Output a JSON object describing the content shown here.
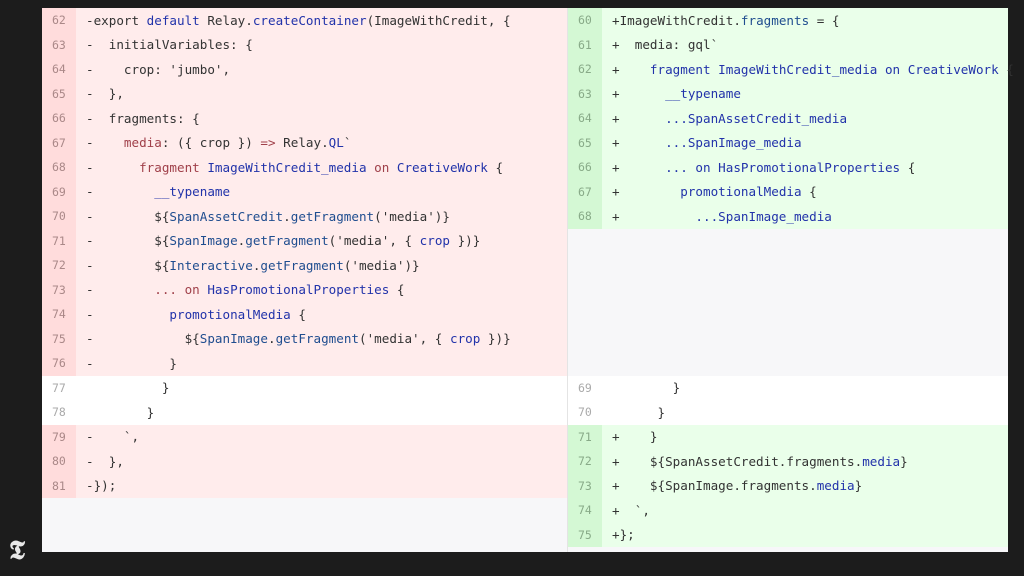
{
  "left": {
    "rows": [
      {
        "n": "62",
        "t": "del",
        "segs": [
          [
            "-export ",
            ""
          ],
          [
            "default ",
            "b"
          ],
          [
            "Relay.",
            ""
          ],
          [
            "createContainer",
            "b"
          ],
          [
            "(ImageWithCredit, {",
            ""
          ]
        ]
      },
      {
        "n": "63",
        "t": "del",
        "segs": [
          [
            "-  initialVariables: {",
            ""
          ]
        ]
      },
      {
        "n": "64",
        "t": "del",
        "segs": [
          [
            "-    crop: 'jumbo',",
            ""
          ]
        ]
      },
      {
        "n": "65",
        "t": "del",
        "segs": [
          [
            "-  },",
            ""
          ]
        ]
      },
      {
        "n": "66",
        "t": "del",
        "segs": [
          [
            "-  fragments: {",
            ""
          ]
        ]
      },
      {
        "n": "67",
        "t": "del",
        "segs": [
          [
            "-    ",
            ""
          ],
          [
            "media",
            "k"
          ],
          [
            ": ({ crop }) ",
            ""
          ],
          [
            "=>",
            "k"
          ],
          [
            " Relay.",
            ""
          ],
          [
            "QL",
            "b"
          ],
          [
            "`",
            ""
          ]
        ]
      },
      {
        "n": "68",
        "t": "del",
        "segs": [
          [
            "-      ",
            ""
          ],
          [
            "fragment ",
            "k"
          ],
          [
            "ImageWithCredit_media ",
            "b"
          ],
          [
            "on ",
            "k"
          ],
          [
            "CreativeWork",
            "b"
          ],
          [
            " {",
            ""
          ]
        ]
      },
      {
        "n": "69",
        "t": "del",
        "segs": [
          [
            "-        ",
            ""
          ],
          [
            "__typename",
            "b"
          ]
        ]
      },
      {
        "n": "70",
        "t": "del",
        "segs": [
          [
            "-        ${",
            ""
          ],
          [
            "SpanAssetCredit",
            "s"
          ],
          [
            ".",
            ""
          ],
          [
            "getFragment",
            "s"
          ],
          [
            "('media')}",
            ""
          ]
        ]
      },
      {
        "n": "71",
        "t": "del",
        "segs": [
          [
            "-        ${",
            ""
          ],
          [
            "SpanImage",
            "s"
          ],
          [
            ".",
            ""
          ],
          [
            "getFragment",
            "s"
          ],
          [
            "('media', { ",
            ""
          ],
          [
            "crop",
            "b"
          ],
          [
            " })}",
            ""
          ]
        ]
      },
      {
        "n": "72",
        "t": "del",
        "segs": [
          [
            "-        ${",
            ""
          ],
          [
            "Interactive",
            "s"
          ],
          [
            ".",
            ""
          ],
          [
            "getFragment",
            "s"
          ],
          [
            "('media')}",
            ""
          ]
        ]
      },
      {
        "n": "73",
        "t": "del",
        "segs": [
          [
            "-        ",
            ""
          ],
          [
            "... on ",
            "k"
          ],
          [
            "HasPromotionalProperties",
            "b"
          ],
          [
            " {",
            ""
          ]
        ]
      },
      {
        "n": "74",
        "t": "del",
        "segs": [
          [
            "-          ",
            ""
          ],
          [
            "promotionalMedia",
            "b"
          ],
          [
            " {",
            ""
          ]
        ]
      },
      {
        "n": "75",
        "t": "del",
        "segs": [
          [
            "-            ${",
            ""
          ],
          [
            "SpanImage",
            "s"
          ],
          [
            ".",
            ""
          ],
          [
            "getFragment",
            "s"
          ],
          [
            "('media', { ",
            ""
          ],
          [
            "crop",
            "b"
          ],
          [
            " })}",
            ""
          ]
        ]
      },
      {
        "n": "76",
        "t": "del",
        "segs": [
          [
            "-          }",
            ""
          ]
        ]
      },
      {
        "n": "77",
        "t": "ctx",
        "segs": [
          [
            "          }",
            ""
          ]
        ]
      },
      {
        "n": "78",
        "t": "ctx",
        "segs": [
          [
            "        }",
            ""
          ]
        ]
      },
      {
        "n": "79",
        "t": "del",
        "segs": [
          [
            "-    `,",
            ""
          ]
        ]
      },
      {
        "n": "80",
        "t": "del",
        "segs": [
          [
            "-  },",
            ""
          ]
        ]
      },
      {
        "n": "81",
        "t": "del",
        "segs": [
          [
            "-});",
            ""
          ]
        ]
      }
    ]
  },
  "right": {
    "rows": [
      {
        "n": "60",
        "t": "add",
        "segs": [
          [
            "+ImageWithCredit.",
            ""
          ],
          [
            "fragments",
            "s"
          ],
          [
            " = {",
            ""
          ]
        ]
      },
      {
        "n": "61",
        "t": "add",
        "segs": [
          [
            "+  media: gql`",
            ""
          ]
        ]
      },
      {
        "n": "62",
        "t": "add",
        "segs": [
          [
            "+    ",
            ""
          ],
          [
            "fragment ImageWithCredit_media on CreativeWork",
            "b"
          ],
          [
            " {",
            ""
          ]
        ]
      },
      {
        "n": "63",
        "t": "add",
        "segs": [
          [
            "+      ",
            ""
          ],
          [
            "__typename",
            "b"
          ]
        ]
      },
      {
        "n": "64",
        "t": "add",
        "segs": [
          [
            "+      ",
            ""
          ],
          [
            "...SpanAssetCredit_media",
            "b"
          ]
        ]
      },
      {
        "n": "65",
        "t": "add",
        "segs": [
          [
            "+      ",
            ""
          ],
          [
            "...SpanImage_media",
            "b"
          ]
        ]
      },
      {
        "n": "66",
        "t": "add",
        "segs": [
          [
            "+      ",
            ""
          ],
          [
            "... on HasPromotionalProperties",
            "b"
          ],
          [
            " {",
            ""
          ]
        ]
      },
      {
        "n": "67",
        "t": "add",
        "segs": [
          [
            "+        ",
            ""
          ],
          [
            "promotionalMedia",
            "b"
          ],
          [
            " {",
            ""
          ]
        ]
      },
      {
        "n": "68",
        "t": "add",
        "segs": [
          [
            "+          ",
            ""
          ],
          [
            "...SpanImage_media",
            "b"
          ]
        ]
      },
      {
        "n": "",
        "t": "empty",
        "segs": []
      },
      {
        "n": "",
        "t": "empty",
        "segs": []
      },
      {
        "n": "",
        "t": "empty",
        "segs": []
      },
      {
        "n": "",
        "t": "empty",
        "segs": []
      },
      {
        "n": "",
        "t": "empty",
        "segs": []
      },
      {
        "n": "",
        "t": "empty",
        "segs": []
      },
      {
        "n": "69",
        "t": "ctx",
        "segs": [
          [
            "        }",
            ""
          ]
        ]
      },
      {
        "n": "70",
        "t": "ctx",
        "segs": [
          [
            "      }",
            ""
          ]
        ]
      },
      {
        "n": "71",
        "t": "add",
        "segs": [
          [
            "+    }",
            ""
          ]
        ]
      },
      {
        "n": "72",
        "t": "add",
        "segs": [
          [
            "+    ${SpanAssetCredit.fragments.",
            ""
          ],
          [
            "media",
            "b"
          ],
          [
            "}",
            ""
          ]
        ]
      },
      {
        "n": "73",
        "t": "add",
        "segs": [
          [
            "+    ${SpanImage.fragments.",
            ""
          ],
          [
            "media",
            "b"
          ],
          [
            "}",
            ""
          ]
        ]
      },
      {
        "n": "74",
        "t": "add",
        "segs": [
          [
            "+  `,",
            ""
          ]
        ]
      },
      {
        "n": "75",
        "t": "add",
        "segs": [
          [
            "+};",
            ""
          ]
        ]
      }
    ]
  },
  "colors": {
    "deleted_bg": "#ffecec",
    "added_bg": "#eaffea",
    "keyword": "#a0404a",
    "identifier": "#2233aa"
  },
  "logo": {
    "glyph": "𝕿",
    "icon": "nyt-logo-icon"
  }
}
